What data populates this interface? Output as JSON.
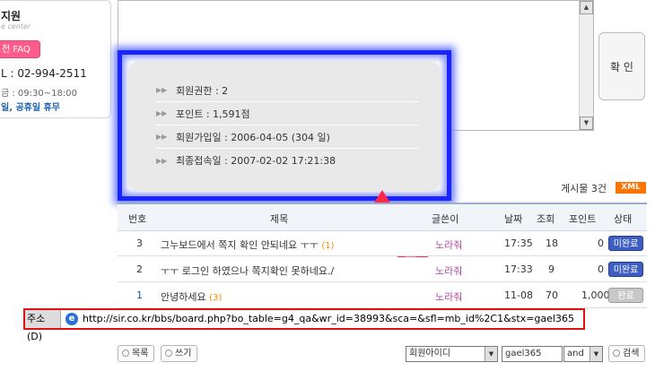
{
  "support": {
    "title": "지원",
    "subtitle": "e center",
    "faq_label": "전 FAQ",
    "phone": "L : 02-994-2511",
    "hours": "금 : 09:30~18:00",
    "holiday": "일, 공휴일 휴무"
  },
  "confirm_label": "확 인",
  "member_info": [
    {
      "text": "회원권한 : 2"
    },
    {
      "text": "포인트 : 1,591점"
    },
    {
      "text": "회원가입일 : 2006-04-05 (304 일)"
    },
    {
      "text": "최종접속일 : 2007-02-02 17:21:38"
    }
  ],
  "board": {
    "count": "게시물 3건",
    "xml": "XML",
    "headers": [
      "번호",
      "제목",
      "글쓴이",
      "날짜",
      "조회",
      "포인트",
      "상태"
    ],
    "rows": [
      {
        "num": "3",
        "title": "그누보드에서 쪽지 확인 안되네요 ㅜㅜ",
        "comments": "(1)",
        "author": "노라줘",
        "date": "17:35",
        "views": "18",
        "points": "0",
        "status": "미완료"
      },
      {
        "num": "2",
        "title": "ㅜㅜ 로그인 하였으나 쪽지확인 못하네요./",
        "comments": "",
        "author": "노라줘",
        "date": "17:33",
        "views": "9",
        "points": "0",
        "status": "미완료"
      },
      {
        "num": "1",
        "title": "안녕하세요",
        "comments": "(3)",
        "author": "노라줘",
        "date": "11-08",
        "views": "70",
        "points": "1,000",
        "status": "완료"
      }
    ]
  },
  "address_bar": {
    "label": "주소(D)",
    "url": "http://sir.co.kr/bbs/board.php?bo_table=g4_qa&wr_id=38993&sca=&sfl=mb_id%2C1&stx=gael365"
  },
  "controls": {
    "list_label": "목록",
    "write_label": "쓰기",
    "field_select": "회원아이디",
    "search_value": "gael365",
    "operator": "and",
    "search_label": "검색"
  },
  "colors": {
    "highlight_border": "#1a24ff",
    "address_border": "#e01010",
    "arrow": "#ff2a4a",
    "xml": "#ff7300"
  }
}
